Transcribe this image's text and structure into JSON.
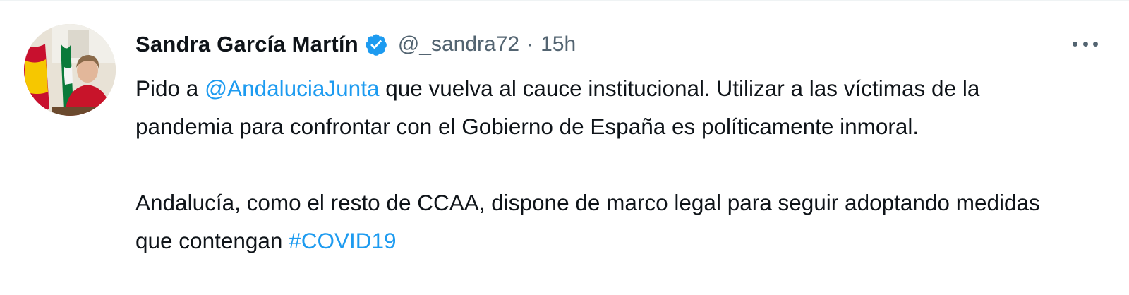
{
  "tweet": {
    "author": {
      "name": "Sandra García Martín",
      "handle": "@_sandra72",
      "verified": true
    },
    "separator": "·",
    "time": "15h",
    "paragraph1": {
      "before": "Pido a ",
      "mention": "@AndaluciaJunta",
      "after": " que vuelva al cauce institucional. Utilizar a las víctimas de la pandemia para confrontar con el Gobierno de España es políticamente inmoral."
    },
    "paragraph2": {
      "before": "Andalucía, como el resto de CCAA, dispone de marco legal para seguir adoptando medidas que contengan ",
      "hashtag": "#COVID19"
    },
    "more_menu_icon": "more-horizontal-icon",
    "colors": {
      "link": "#1d9bf0",
      "verified": "#1d9bf0",
      "secondary_text": "#536471",
      "primary_text": "#0f1419"
    }
  }
}
